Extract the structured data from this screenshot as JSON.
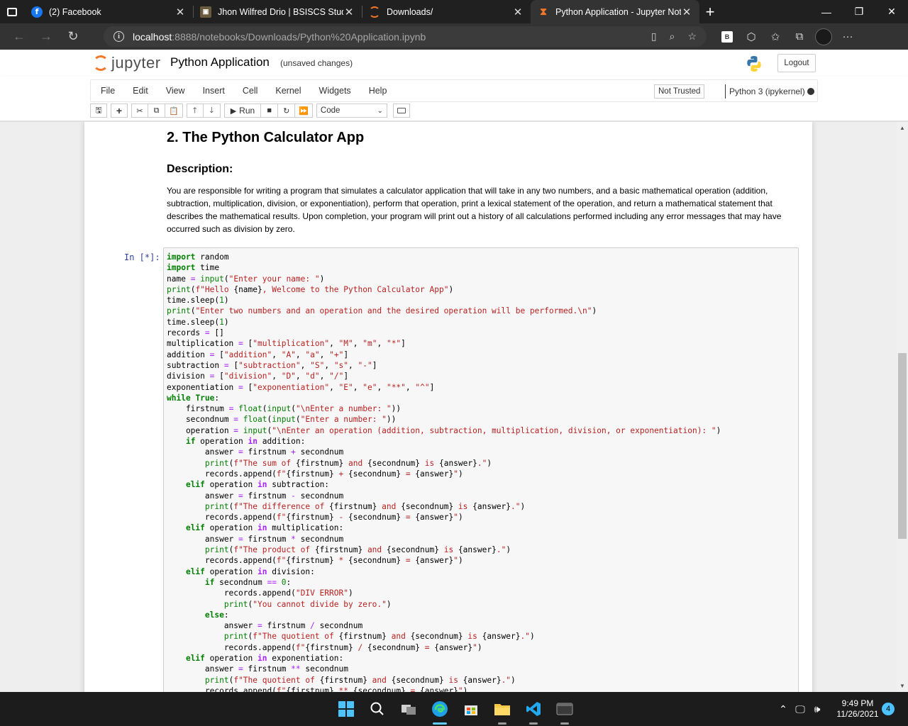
{
  "browser": {
    "tabs": [
      {
        "title": "(2) Facebook",
        "icon": "facebook-icon"
      },
      {
        "title": "Jhon Wilfred Drio | BSISCS Stude",
        "icon": "profile-image-icon"
      },
      {
        "title": "Downloads/",
        "icon": "jupyter-icon"
      },
      {
        "title": "Python Application - Jupyter Not",
        "icon": "hourglass-icon"
      }
    ],
    "url_host": "localhost",
    "url_rest": ":8888/notebooks/Downloads/Python%20Application.ipynb",
    "b_badge": "B"
  },
  "jupyter": {
    "logo_text": "jupyter",
    "notebook_title": "Python Application",
    "save_status": "(unsaved changes)",
    "logout_label": "Logout",
    "menu": [
      "File",
      "Edit",
      "View",
      "Insert",
      "Cell",
      "Kernel",
      "Widgets",
      "Help"
    ],
    "trust_status": "Not Trusted",
    "kernel": "Python 3 (ipykernel)",
    "run_label": "Run",
    "cell_type": "Code"
  },
  "notebook": {
    "heading": "2. The Python Calculator App",
    "subheading": "Description:",
    "description": "You are responsible for writing a program that simulates a calculator application that will take in any two numbers, and a basic mathematical operation (addition, subtraction, multiplication, division, or exponentiation), perform that operation, print a lexical statement of the operation, and return a mathematical statement that describes the mathematical results. Upon completion, your program will print out a history of all calculations performed including any error messages that may have occurred such as division by zero.",
    "prompt": "In [*]:"
  },
  "taskbar": {
    "time": "9:49 PM",
    "date": "11/26/2021",
    "notifications": "4"
  },
  "colors": {
    "jupyter_orange": "#f37726",
    "prompt_blue": "#303f9f",
    "keyword_green": "#008000",
    "string_red": "#ba2121",
    "operator_purple": "#aa22ff"
  }
}
